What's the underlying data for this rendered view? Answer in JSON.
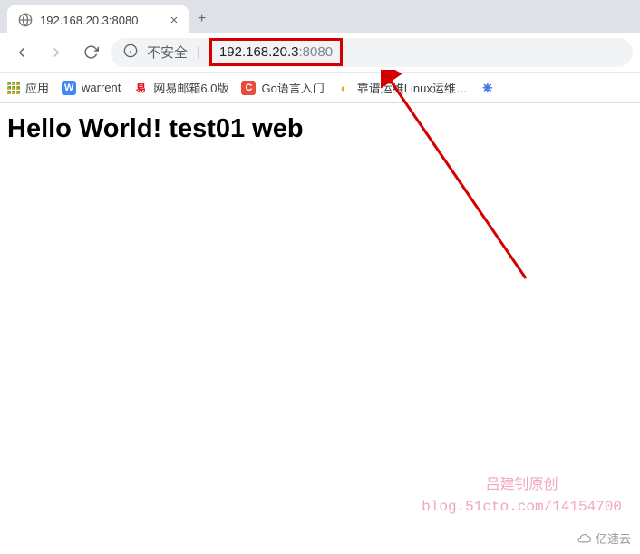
{
  "tab": {
    "title": "192.168.20.3:8080"
  },
  "nav": {
    "security_label": "不安全",
    "url_host": "192.168.20.3",
    "url_port": ":8080"
  },
  "bookmarks": {
    "apps": "应用",
    "items": [
      {
        "label": "warrent"
      },
      {
        "label": "网易邮箱6.0版"
      },
      {
        "label": "Go语言入门"
      },
      {
        "label": "靠谱运维Linux运维…"
      }
    ]
  },
  "page": {
    "heading": "Hello World! test01 web"
  },
  "watermark": {
    "line1": "吕建钊原创",
    "line2": "blog.51cto.com/14154700"
  },
  "corner": {
    "label": "亿速云"
  }
}
